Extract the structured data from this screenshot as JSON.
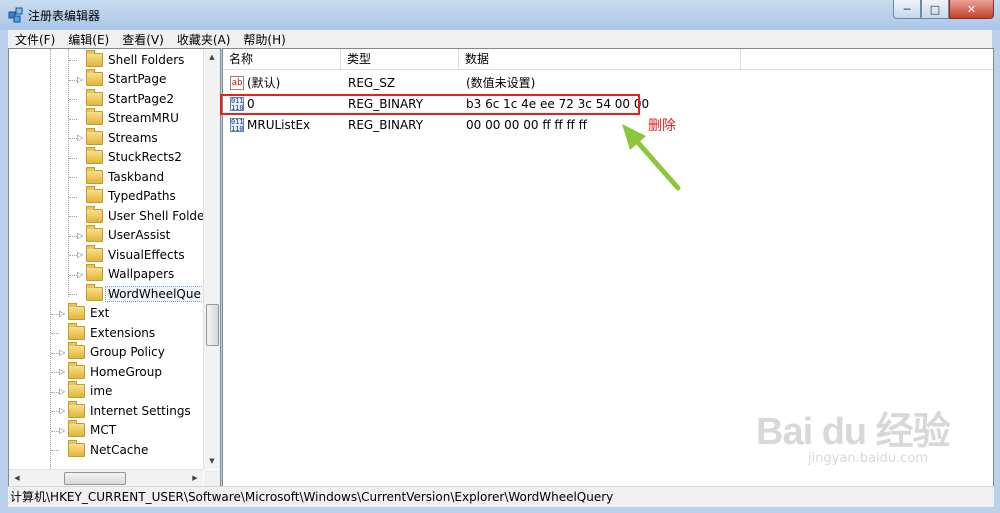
{
  "window": {
    "title": "注册表编辑器",
    "minimize": "─",
    "maximize": "□",
    "close": "✕"
  },
  "menu": [
    "文件(F)",
    "编辑(E)",
    "查看(V)",
    "收藏夹(A)",
    "帮助(H)"
  ],
  "tree": {
    "sub_items": [
      {
        "label": "Shell Folders",
        "expandable": false
      },
      {
        "label": "StartPage",
        "expandable": true
      },
      {
        "label": "StartPage2",
        "expandable": false
      },
      {
        "label": "StreamMRU",
        "expandable": false
      },
      {
        "label": "Streams",
        "expandable": true
      },
      {
        "label": "StuckRects2",
        "expandable": false
      },
      {
        "label": "Taskband",
        "expandable": false
      },
      {
        "label": "TypedPaths",
        "expandable": false
      },
      {
        "label": "User Shell Folde",
        "expandable": false
      },
      {
        "label": "UserAssist",
        "expandable": true
      },
      {
        "label": "VisualEffects",
        "expandable": true
      },
      {
        "label": "Wallpapers",
        "expandable": true
      },
      {
        "label": "WordWheelQue",
        "expandable": false,
        "selected": true
      }
    ],
    "top_items": [
      {
        "label": "Ext",
        "expandable": true
      },
      {
        "label": "Extensions",
        "expandable": false
      },
      {
        "label": "Group Policy",
        "expandable": true
      },
      {
        "label": "HomeGroup",
        "expandable": true
      },
      {
        "label": "ime",
        "expandable": true
      },
      {
        "label": "Internet Settings",
        "expandable": true
      },
      {
        "label": "MCT",
        "expandable": true
      },
      {
        "label": "NetCache",
        "expandable": false
      }
    ]
  },
  "list": {
    "columns": [
      "名称",
      "类型",
      "数据"
    ],
    "rows": [
      {
        "icon": "string-value-icon",
        "name": "(默认)",
        "type": "REG_SZ",
        "data": "(数值未设置)"
      },
      {
        "icon": "binary-value-icon",
        "name": "0",
        "type": "REG_BINARY",
        "data": "b3 6c 1c 4e ee 72 3c 54 00 00"
      },
      {
        "icon": "binary-value-icon",
        "name": "MRUListEx",
        "type": "REG_BINARY",
        "data": "00 00 00 00 ff ff ff ff"
      }
    ]
  },
  "annotation": {
    "text": "删除",
    "color": "#e2231a",
    "arrow_color": "#8cc63f"
  },
  "status": {
    "path": "计算机\\HKEY_CURRENT_USER\\Software\\Microsoft\\Windows\\CurrentVersion\\Explorer\\WordWheelQuery"
  },
  "watermark": {
    "logo": "Bai du 经验",
    "url": "jingyan.baidu.com"
  }
}
